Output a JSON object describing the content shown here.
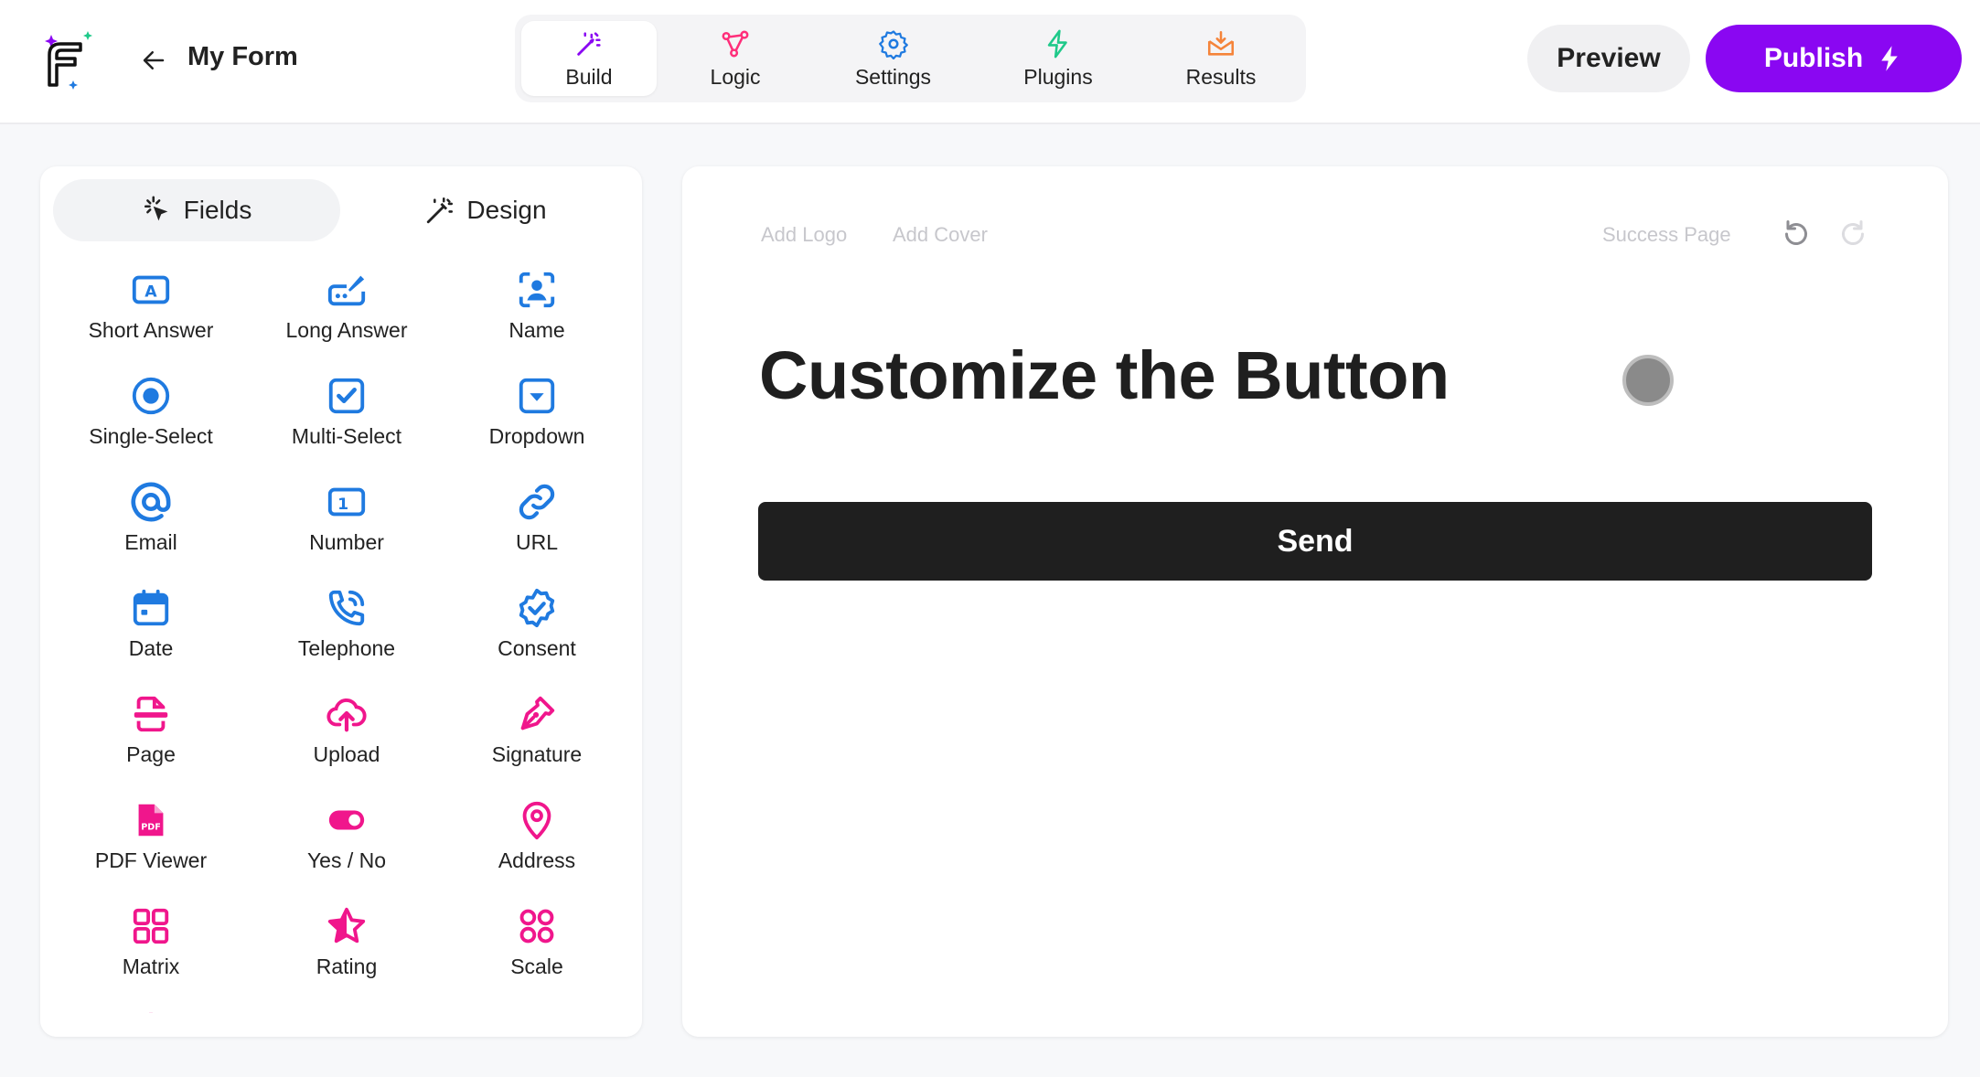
{
  "header": {
    "form_name": "My Form",
    "tabs": [
      {
        "label": "Build",
        "icon": "magic-wand-icon",
        "color": "#8a07f2",
        "active": true
      },
      {
        "label": "Logic",
        "icon": "nodes-icon",
        "color": "#ff2e7a"
      },
      {
        "label": "Settings",
        "icon": "gear-icon",
        "color": "#1f7ae0"
      },
      {
        "label": "Plugins",
        "icon": "lightning-icon",
        "color": "#1fc98a"
      },
      {
        "label": "Results",
        "icon": "inbox-icon",
        "color": "#f5843a"
      }
    ],
    "preview_label": "Preview",
    "publish_label": "Publish"
  },
  "panel": {
    "fields_tab": "Fields",
    "design_tab": "Design",
    "fields": [
      {
        "label": "Short Answer",
        "icon": "text-box-icon",
        "color": "#1f7ae0"
      },
      {
        "label": "Long Answer",
        "icon": "pen-box-icon",
        "color": "#1f7ae0"
      },
      {
        "label": "Name",
        "icon": "person-scan-icon",
        "color": "#1f7ae0"
      },
      {
        "label": "Single-Select",
        "icon": "radio-icon",
        "color": "#1f7ae0"
      },
      {
        "label": "Multi-Select",
        "icon": "checkbox-icon",
        "color": "#1f7ae0"
      },
      {
        "label": "Dropdown",
        "icon": "dropdown-icon",
        "color": "#1f7ae0"
      },
      {
        "label": "Email",
        "icon": "at-icon",
        "color": "#1f7ae0"
      },
      {
        "label": "Number",
        "icon": "number-icon",
        "color": "#1f7ae0"
      },
      {
        "label": "URL",
        "icon": "link-icon",
        "color": "#1f7ae0"
      },
      {
        "label": "Date",
        "icon": "calendar-icon",
        "color": "#1f7ae0"
      },
      {
        "label": "Telephone",
        "icon": "phone-icon",
        "color": "#1f7ae0"
      },
      {
        "label": "Consent",
        "icon": "badge-check-icon",
        "color": "#1f7ae0"
      },
      {
        "label": "Page",
        "icon": "page-icon",
        "color": "#f0168c"
      },
      {
        "label": "Upload",
        "icon": "cloud-upload-icon",
        "color": "#f0168c"
      },
      {
        "label": "Signature",
        "icon": "pen-nib-icon",
        "color": "#f0168c"
      },
      {
        "label": "PDF Viewer",
        "icon": "pdf-icon",
        "color": "#f0168c"
      },
      {
        "label": "Yes / No",
        "icon": "toggle-icon",
        "color": "#f0168c"
      },
      {
        "label": "Address",
        "icon": "map-pin-icon",
        "color": "#f0168c"
      },
      {
        "label": "Matrix",
        "icon": "grid-icon",
        "color": "#f0168c"
      },
      {
        "label": "Rating",
        "icon": "star-icon",
        "color": "#f0168c"
      },
      {
        "label": "Scale",
        "icon": "dots-grid-icon",
        "color": "#f0168c"
      },
      {
        "label": "",
        "icon": "target-icon",
        "color": "#f0168c"
      },
      {
        "label": "",
        "icon": "gauge-icon",
        "color": "#f0168c"
      }
    ]
  },
  "canvas": {
    "add_logo": "Add Logo",
    "add_cover": "Add Cover",
    "success_page": "Success Page",
    "title": "Customize the Button",
    "send_label": "Send"
  }
}
